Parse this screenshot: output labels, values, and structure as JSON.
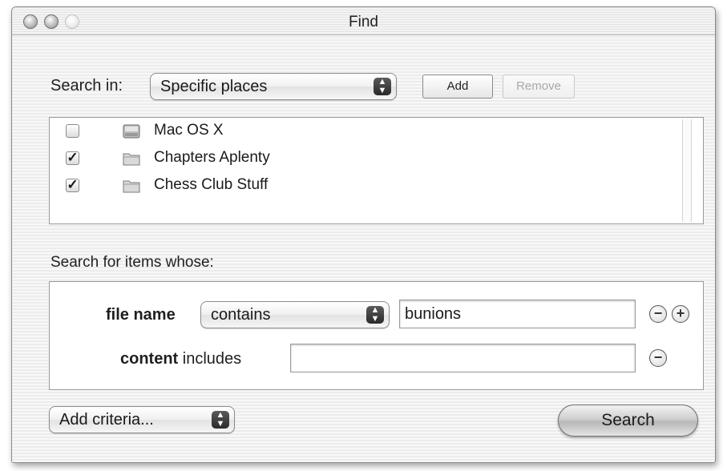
{
  "window": {
    "title": "Find"
  },
  "search_in": {
    "label": "Search in:",
    "selected": "Specific places",
    "add_label": "Add",
    "remove_label": "Remove"
  },
  "places": [
    {
      "name": "Mac OS X",
      "checked": false,
      "icon": "hard-disk-icon"
    },
    {
      "name": "Chapters Aplenty",
      "checked": true,
      "icon": "folder-icon"
    },
    {
      "name": "Chess Club Stuff",
      "checked": true,
      "icon": "folder-icon"
    }
  ],
  "search_for": {
    "label": "Search for items whose:"
  },
  "criteria": {
    "file_name": {
      "label_bold": "file name",
      "operator": "contains",
      "value": "bunions"
    },
    "content": {
      "label_bold": "content",
      "label_rest": "includes",
      "value": ""
    }
  },
  "footer": {
    "add_criteria": "Add criteria...",
    "search_label": "Search"
  },
  "glyphs": {
    "check": "✓",
    "minus": "−",
    "plus": "+",
    "up_down": "▲▼"
  }
}
